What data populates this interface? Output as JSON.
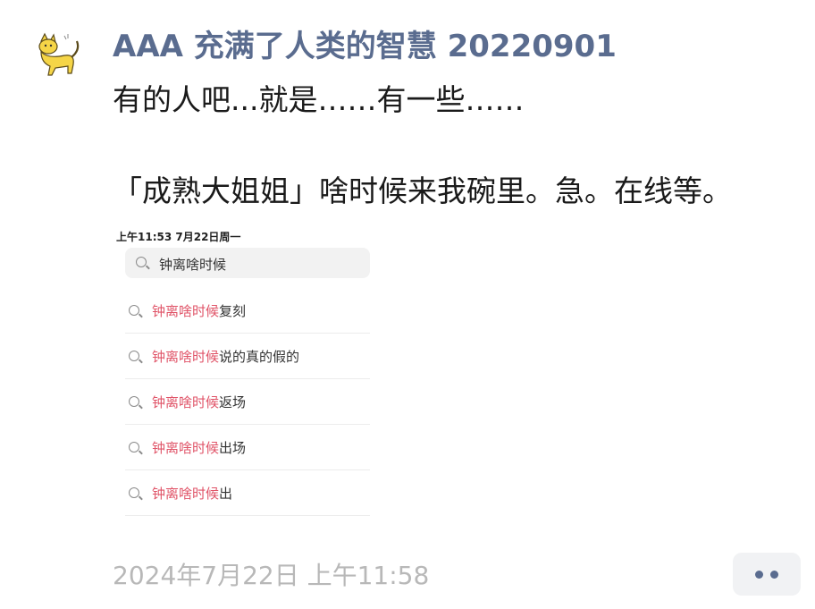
{
  "post": {
    "author": "AAA 充满了人类的智慧 20220901",
    "avatar_icon": "cat-icon",
    "lines": [
      "有的人吧...就是……有一些……",
      "「成熟大姐姐」啥时候来我碗里。急。在线等。"
    ],
    "timestamp": "2024年7月22日 上午11:58"
  },
  "screenshot": {
    "status": "上午11:53   7月22日周一",
    "search_text": "钟离啥时候",
    "suggestions": [
      {
        "highlight": "钟离啥时候",
        "rest": "复刻"
      },
      {
        "highlight": "钟离啥时候",
        "rest": "说的真的假的"
      },
      {
        "highlight": "钟离啥时候",
        "rest": "返场"
      },
      {
        "highlight": "钟离啥时候",
        "rest": "出场"
      },
      {
        "highlight": "钟离啥时候",
        "rest": "出"
      }
    ]
  },
  "colors": {
    "author": "#5a6c8f",
    "highlight": "#e05468",
    "timestamp": "#b8b8b8"
  }
}
